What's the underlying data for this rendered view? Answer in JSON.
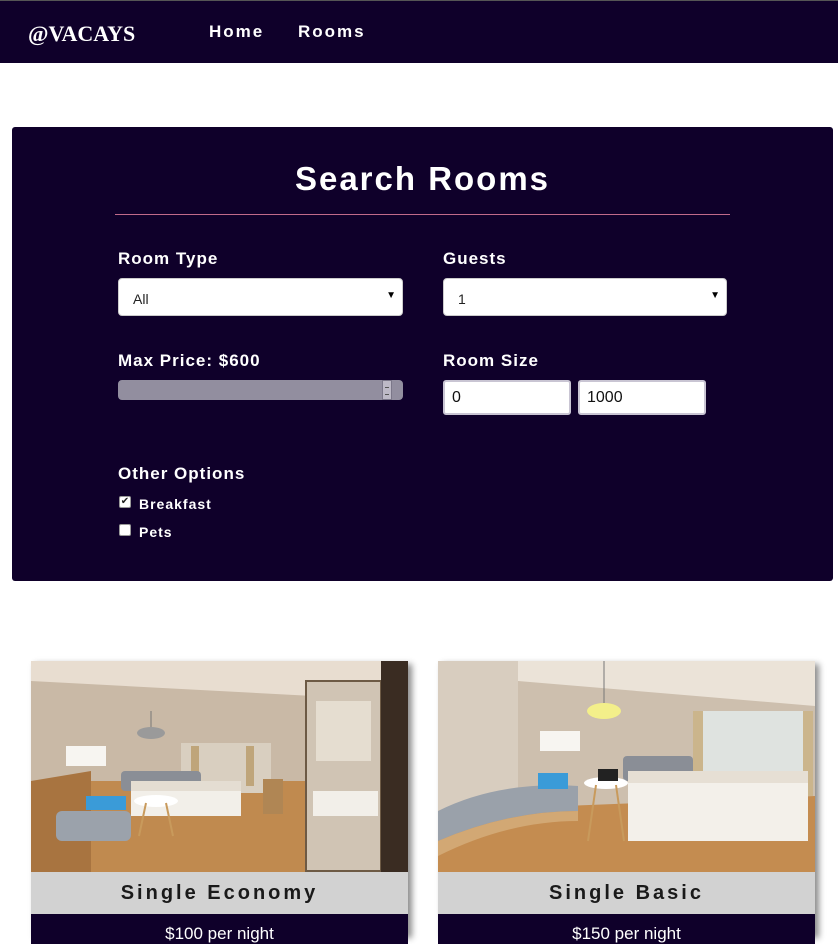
{
  "navbar": {
    "logo": "@VACAYS",
    "links": [
      {
        "label": "Home"
      },
      {
        "label": "Rooms"
      }
    ]
  },
  "search": {
    "title": "Search Rooms",
    "room_type": {
      "label": "Room Type",
      "value": "All"
    },
    "guests": {
      "label": "Guests",
      "value": "1"
    },
    "max_price": {
      "label": "Max Price: $600",
      "value_fraction": 0.95
    },
    "room_size": {
      "label": "Room Size",
      "min": "0",
      "max": "1000"
    },
    "other_options": {
      "label": "Other Options",
      "breakfast": {
        "label": "Breakfast",
        "checked": true
      },
      "pets": {
        "label": "Pets",
        "checked": false
      }
    }
  },
  "rooms": [
    {
      "name": "Single Economy",
      "price": "$100 per night"
    },
    {
      "name": "Single Basic",
      "price": "$150 per night"
    }
  ],
  "colors": {
    "navy": "#0f002a",
    "accent_rule": "#c06a8a",
    "name_bar": "#d2d2d2"
  }
}
